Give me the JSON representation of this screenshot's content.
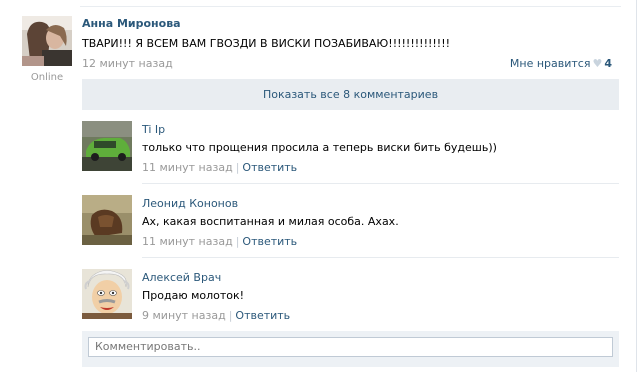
{
  "post": {
    "author": "Анна Миронова",
    "status": "Online",
    "text": "ТВАРИ!!! Я ВСЕМ ВАМ ГВОЗДИ В ВИСКИ ПОЗАБИВАЮ!!!!!!!!!!!!!!",
    "time": "12 минут назад",
    "like_label": "Мне нравится",
    "like_count": "4"
  },
  "show_all_comments": "Показать все 8 комментариев",
  "comments": [
    {
      "name": "Ti Ip",
      "text": "только что прощения просила а теперь виски бить будешь))",
      "time": "11 минут назад",
      "reply": "Ответить"
    },
    {
      "name": "Леонид Кононов",
      "text": "Ах, какая воспитанная и милая особа. Ахах.",
      "time": "11 минут назад",
      "reply": "Ответить"
    },
    {
      "name": "Алексей Врач",
      "text": "Продаю молоток!",
      "time": "9 минут назад",
      "reply": "Ответить"
    }
  ],
  "comment_input": {
    "placeholder": "Комментировать.."
  },
  "colors": {
    "link": "#2b587a",
    "muted": "#999999",
    "panel": "#e9edf1"
  }
}
